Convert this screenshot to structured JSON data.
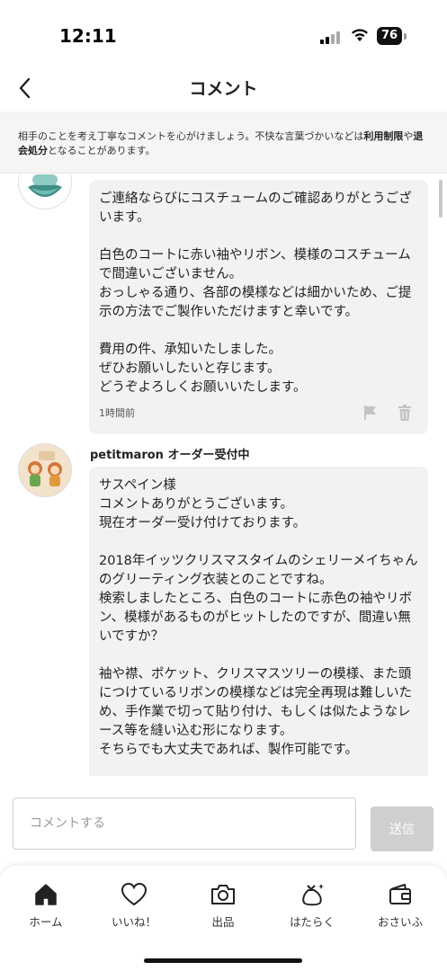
{
  "status_bar": {
    "time": "12:11",
    "battery": "76"
  },
  "nav": {
    "title": "コメント"
  },
  "notice": {
    "part1": "相手のことを考え丁寧なコメントを心がけましょう。不快な言葉づかいなどは",
    "bold1": "利用制限",
    "part2": "や",
    "bold2": "退会処分",
    "part3": "となることがあります。"
  },
  "comments": [
    {
      "text": "ご連絡ならびにコスチュームのご確認ありがとうございます。\n\n白色のコートに赤い袖やリボン、模様のコスチュームで間違いございません。\nおっしゃる通り、各部の模様などは細かいため、ご提示の方法でご製作いただけますと幸いです。\n\n費用の件、承知いたしました。\nぜひお願いしたいと存じます。\nどうぞよろしくお願いいたします。",
      "time": "1時間前"
    },
    {
      "author": "petitmaron オーダー受付中",
      "text": "サスペイン様\nコメントありがとうございます。\n現在オーダー受け付けております。\n\n2018年イッツクリスマスタイムのシェリーメイちゃんのグリーティング衣装とのことですね。\n検索しましたところ、白色のコートに赤色の袖やリボン、模様があるものがヒットしたのですが、間違い無いですか？\n\n袖や襟、ポケット、クリスマスツリーの模様、また頭につけているリボンの模様などは完全再現は難しいため、手作業で切って貼り付け、もしくは似たようなレース等を縫い込む形になります。\nそちらでも大丈夫であれば、製作可能です。"
    }
  ],
  "input": {
    "placeholder": "コメントする",
    "send_label": "送信"
  },
  "tabs": [
    {
      "label": "ホーム",
      "icon": "home-icon"
    },
    {
      "label": "いいね！",
      "icon": "heart-icon"
    },
    {
      "label": "出品",
      "icon": "camera-icon"
    },
    {
      "label": "はたらく",
      "icon": "money-bag-icon"
    },
    {
      "label": "おさいふ",
      "icon": "wallet-icon"
    }
  ],
  "colors": {
    "send_disabled": "#cfcfcf",
    "bubble": "#f2f2f2",
    "notice_bg": "#f5f5f5"
  }
}
